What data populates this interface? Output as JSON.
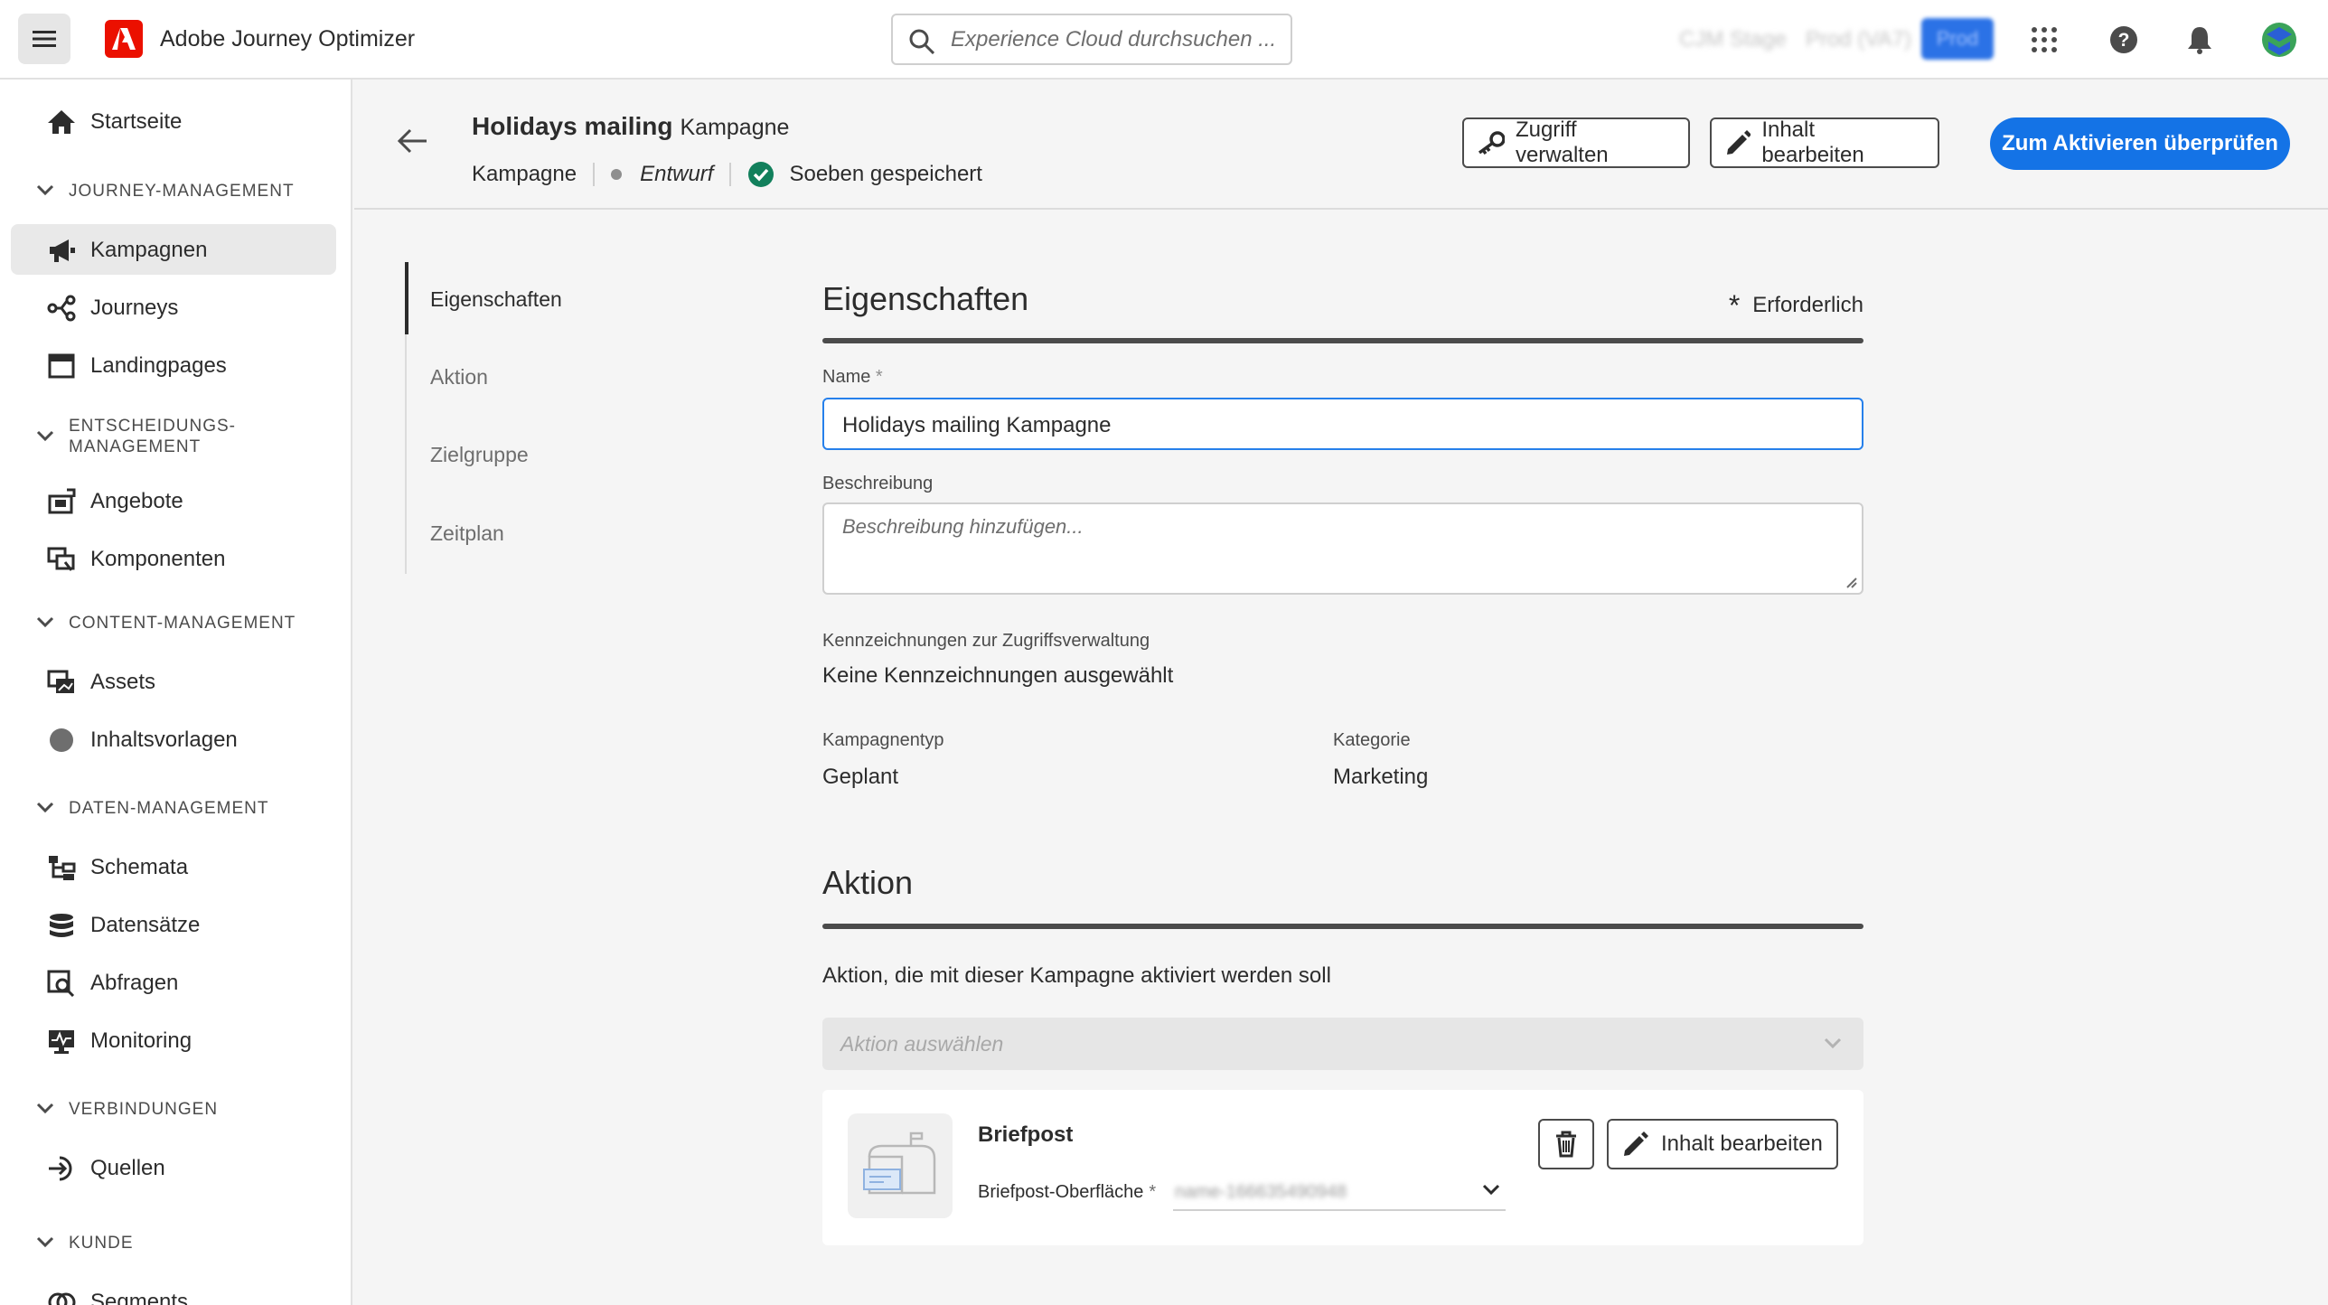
{
  "app": {
    "name": "Adobe Journey Optimizer",
    "search_placeholder": "Experience Cloud durchsuchen ...",
    "org_blurred": "CJM Stage",
    "sandbox_blurred": "Prod (VA7)",
    "env_blurred": "Prod"
  },
  "sidebar": {
    "home": "Startseite",
    "sections": [
      {
        "title": "JOURNEY-MANAGEMENT",
        "items": [
          "Kampagnen",
          "Journeys",
          "Landingpages"
        ]
      },
      {
        "title_line1": "ENTSCHEIDUNGS-",
        "title_line2": "MANAGEMENT",
        "items": [
          "Angebote",
          "Komponenten"
        ]
      },
      {
        "title": "CONTENT-MANAGEMENT",
        "items": [
          "Assets",
          "Inhaltsvorlagen"
        ]
      },
      {
        "title": "DATEN-MANAGEMENT",
        "items": [
          "Schemata",
          "Datensätze",
          "Abfragen",
          "Monitoring"
        ]
      },
      {
        "title": "VERBINDUNGEN",
        "items": [
          "Quellen"
        ]
      },
      {
        "title": "KUNDE",
        "items": [
          "Segments"
        ]
      }
    ]
  },
  "header": {
    "title": "Holidays mailing",
    "title_suffix": "Kampagne",
    "type": "Kampagne",
    "status": "Entwurf",
    "saved": "Soeben gespeichert",
    "btn_access": "Zugriff verwalten",
    "btn_edit": "Inhalt bearbeiten",
    "btn_review": "Zum Aktivieren überprüfen"
  },
  "anchors": [
    "Eigenschaften",
    "Aktion",
    "Zielgruppe",
    "Zeitplan"
  ],
  "properties": {
    "title": "Eigenschaften",
    "required": "Erforderlich",
    "name_label": "Name",
    "name_value": "Holidays mailing Kampagne",
    "desc_label": "Beschreibung",
    "desc_placeholder": "Beschreibung hinzufügen...",
    "labels_label": "Kennzeichnungen zur Zugriffsverwaltung",
    "labels_value": "Keine Kennzeichnungen ausgewählt",
    "type_label": "Kampagnentyp",
    "type_value": "Geplant",
    "category_label": "Kategorie",
    "category_value": "Marketing"
  },
  "action": {
    "title": "Aktion",
    "description": "Aktion, die mit dieser Kampagne aktiviert werden soll",
    "select_placeholder": "Aktion auswählen",
    "card_title": "Briefpost",
    "surface_label": "Briefpost-Oberfläche",
    "surface_value_blurred": "name-166635490948",
    "card_edit": "Inhalt bearbeiten"
  },
  "colors": {
    "accent": "#1473e6",
    "adobe_red": "#eb1000",
    "saved_green": "#12805c"
  }
}
